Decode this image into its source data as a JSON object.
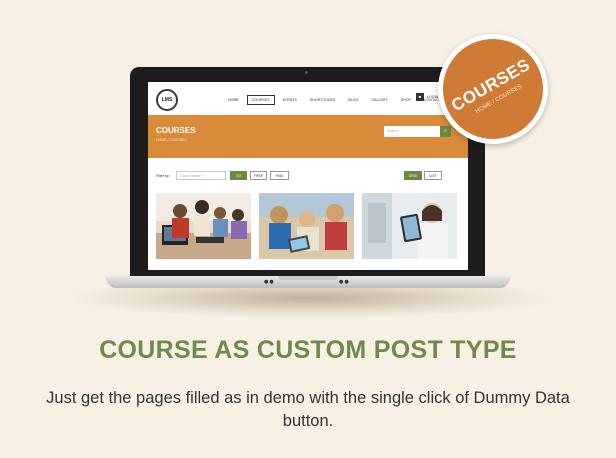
{
  "colors": {
    "background": "#f8f0e4",
    "brand_orange": "#d98b3a",
    "badge_orange": "#cf7a35",
    "brand_green": "#6f8a4e",
    "button_green": "#6b8a3e"
  },
  "badge": {
    "title": "COURSES",
    "subtitle": "HOME / COURSES"
  },
  "site": {
    "logo": "LMS",
    "nav": [
      "HOME",
      "COURSES",
      "EVENTS",
      "SHORTCODES",
      "BLOG",
      "GALLERY",
      "SHOP",
      "CONTACT"
    ],
    "nav_tail": "LOGIN",
    "cart_icon": "cart-icon",
    "banner": {
      "title": "COURSES",
      "breadcrumb": "HOME / COURSES",
      "search_placeholder": "Search..."
    },
    "filters": {
      "label": "Filter by:",
      "input_placeholder": "Course Name",
      "go": "GO",
      "free": "FREE",
      "paid": "PAID",
      "grid": "GRID",
      "list": "LIST"
    },
    "cards": [
      {
        "image": "children-learning-with-teacher",
        "meta": ""
      },
      {
        "image": "kids-with-tablet",
        "meta": ""
      },
      {
        "image": "woman-with-tablet",
        "meta": ""
      }
    ]
  },
  "headline": "COURSE AS CUSTOM POST TYPE",
  "subline": "Just get the pages filled as in demo with the single click of Dummy Data button."
}
